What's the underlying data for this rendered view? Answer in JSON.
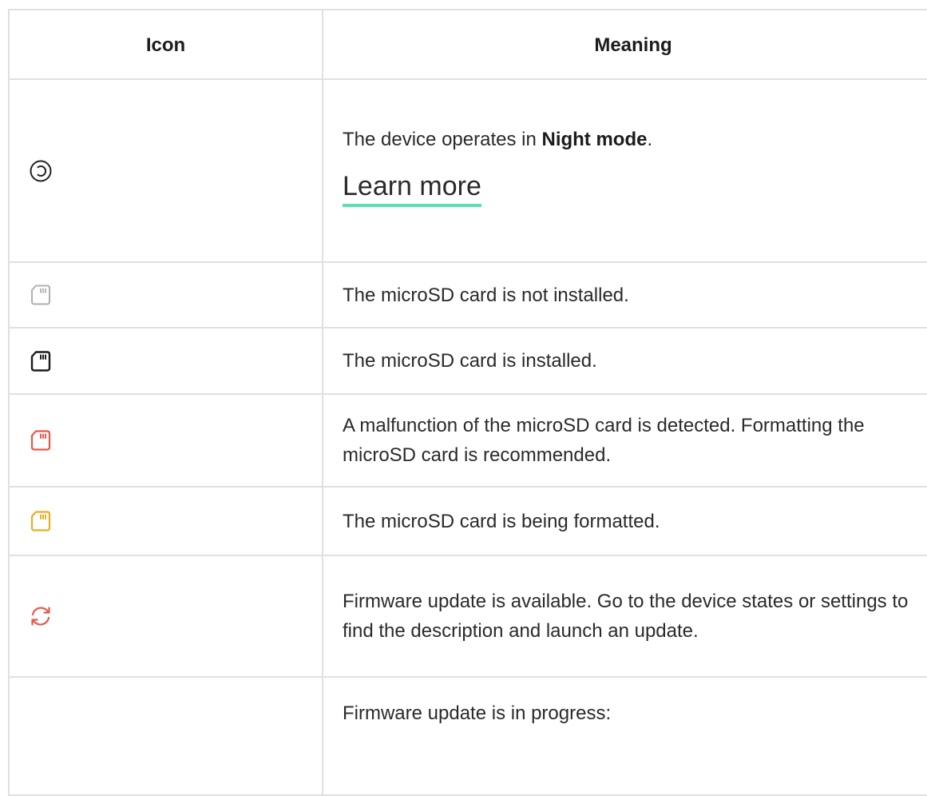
{
  "header": {
    "icon_label": "Icon",
    "meaning_label": "Meaning"
  },
  "rows": [
    {
      "icon": "night-mode-icon",
      "icon_color": "#222222",
      "text_pre": "The device operates in ",
      "text_bold": "Night mode",
      "text_post": ".",
      "link": "Learn more"
    },
    {
      "icon": "microsd-not-installed-icon",
      "icon_color": "#b0b0b0",
      "text": "The microSD card is not installed."
    },
    {
      "icon": "microsd-installed-icon",
      "icon_color": "#1c1c1c",
      "text": "The microSD card is installed."
    },
    {
      "icon": "microsd-malfunction-icon",
      "icon_color": "#e8574a",
      "text": "A malfunction of the microSD card is detected. Formatting the microSD card is recommended."
    },
    {
      "icon": "microsd-formatting-icon",
      "icon_color": "#e8b020",
      "text": "The microSD card is being formatted."
    },
    {
      "icon": "firmware-update-icon",
      "icon_color": "#e8574a",
      "text": "Firmware update is available. Go to the device states or settings to find the description and launch an update."
    },
    {
      "icon": "",
      "text": "Firmware update is in progress:"
    }
  ],
  "colors": {
    "border": "#e0e0e0",
    "link_underline": "#59e0b0",
    "text": "#2a2a2a"
  }
}
